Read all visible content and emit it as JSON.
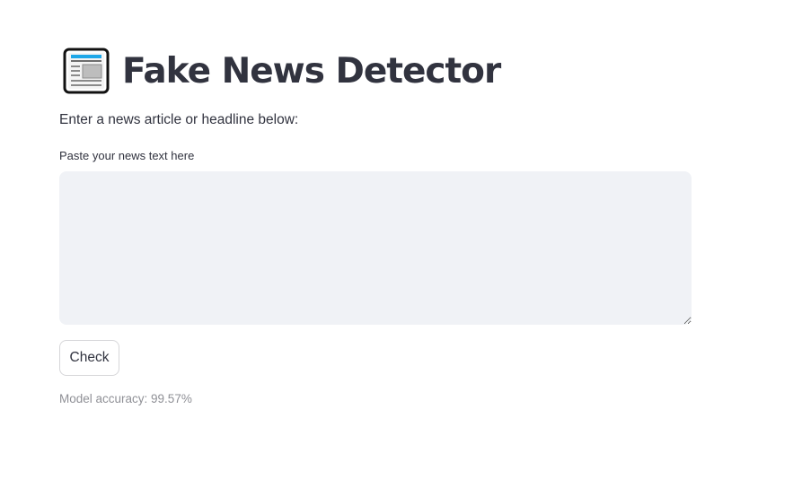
{
  "header": {
    "icon": "newspaper-icon",
    "title": "Fake News Detector"
  },
  "intro_text": "Enter a news article or headline below:",
  "news_input": {
    "label": "Paste your news text here",
    "value": "",
    "placeholder": ""
  },
  "check_button_label": "Check",
  "accuracy_text": "Model accuracy: 99.57%",
  "colors": {
    "text": "#31333f",
    "input_background": "#f0f2f6",
    "muted_text": "#8f9096",
    "button_border": "#d6d6d9",
    "icon_accent": "#1ea7e8"
  }
}
